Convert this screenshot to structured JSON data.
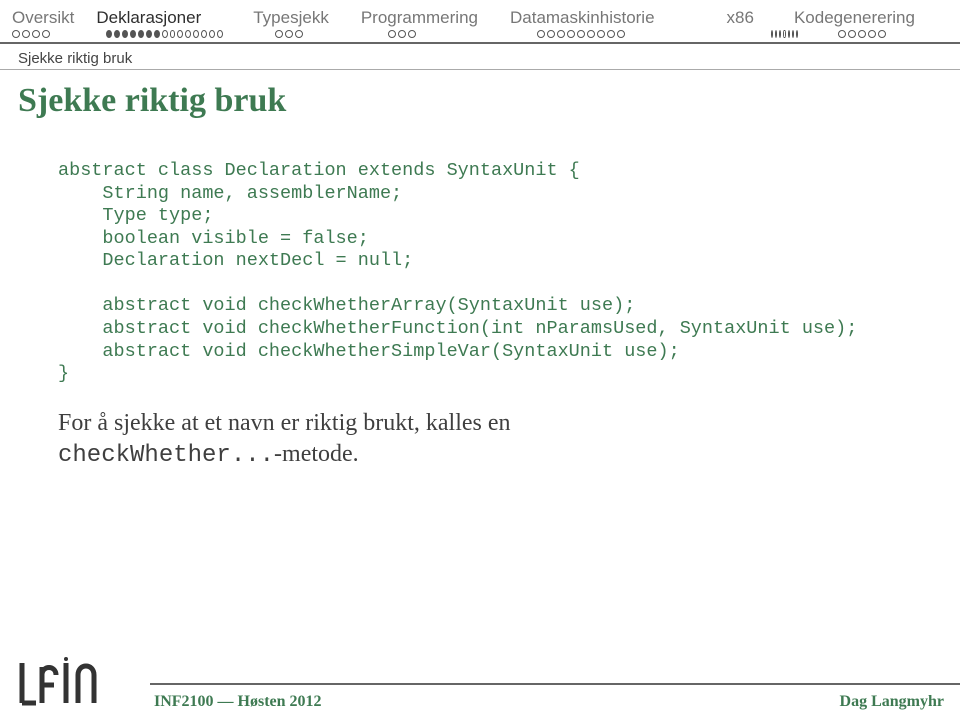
{
  "nav": {
    "items": [
      {
        "label": "Oversikt",
        "active": false,
        "dots_total": 4,
        "dots_filled": 0
      },
      {
        "label": "Deklarasjoner",
        "active": true,
        "dots_total": 15,
        "dots_filled": 7
      },
      {
        "label": "Typesjekk",
        "active": false,
        "dots_total": 3,
        "dots_filled": 0
      },
      {
        "label": "Programmering",
        "active": false,
        "dots_total": 3,
        "dots_filled": 0
      },
      {
        "label": "Datamaskinhistorie",
        "active": false,
        "dots_total": 9,
        "dots_filled": 0
      },
      {
        "label": "x86",
        "active": false,
        "dots_total": 7,
        "dots_filled": 0
      },
      {
        "label": "Kodegenerering",
        "active": false,
        "dots_total": 5,
        "dots_filled": 0
      }
    ]
  },
  "subhead": "Sjekke riktig bruk",
  "title": "Sjekke riktig bruk",
  "code_lines": [
    "abstract class Declaration extends SyntaxUnit {",
    "    String name, assemblerName;",
    "    Type type;",
    "    boolean visible = false;",
    "    Declaration nextDecl = null;",
    "",
    "    abstract void checkWhetherArray(SyntaxUnit use);",
    "    abstract void checkWhetherFunction(int nParamsUsed, SyntaxUnit use);",
    "    abstract void checkWhetherSimpleVar(SyntaxUnit use);",
    "}"
  ],
  "body": {
    "part1": "For å sjekke at et navn er riktig brukt, kalles en",
    "mono": "checkWhether...",
    "part2": "-metode."
  },
  "footer": {
    "left": "INF2100 — Høsten 2012",
    "right": "Dag Langmyhr"
  }
}
